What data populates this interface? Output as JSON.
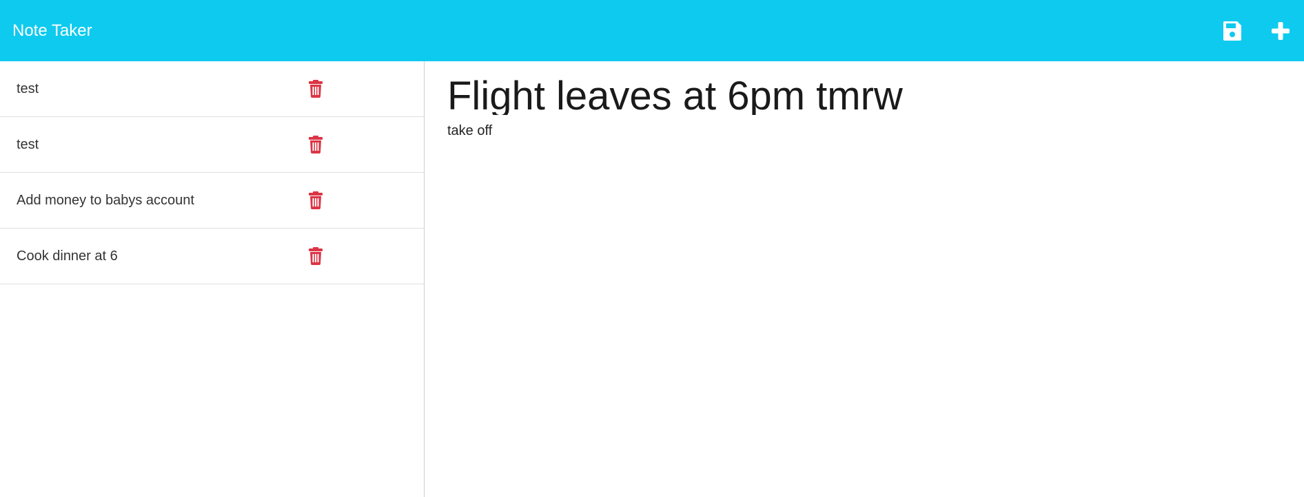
{
  "app": {
    "brand": "Note Taker"
  },
  "navbar": {
    "background": "#0fcaef",
    "icons": [
      "save-icon",
      "plus-icon"
    ]
  },
  "notes": [
    {
      "title": "test",
      "icon": "trash-icon"
    },
    {
      "title": "test",
      "icon": "trash-icon"
    },
    {
      "title": "Add money to babys account",
      "icon": "trash-icon"
    },
    {
      "title": "Cook dinner at 6",
      "icon": "trash-icon"
    }
  ],
  "active_note": {
    "title": "Flight leaves at 6pm tmrw",
    "text": "take off"
  },
  "colors": {
    "accent": "#0fcaef",
    "delete": "#dc3545"
  }
}
